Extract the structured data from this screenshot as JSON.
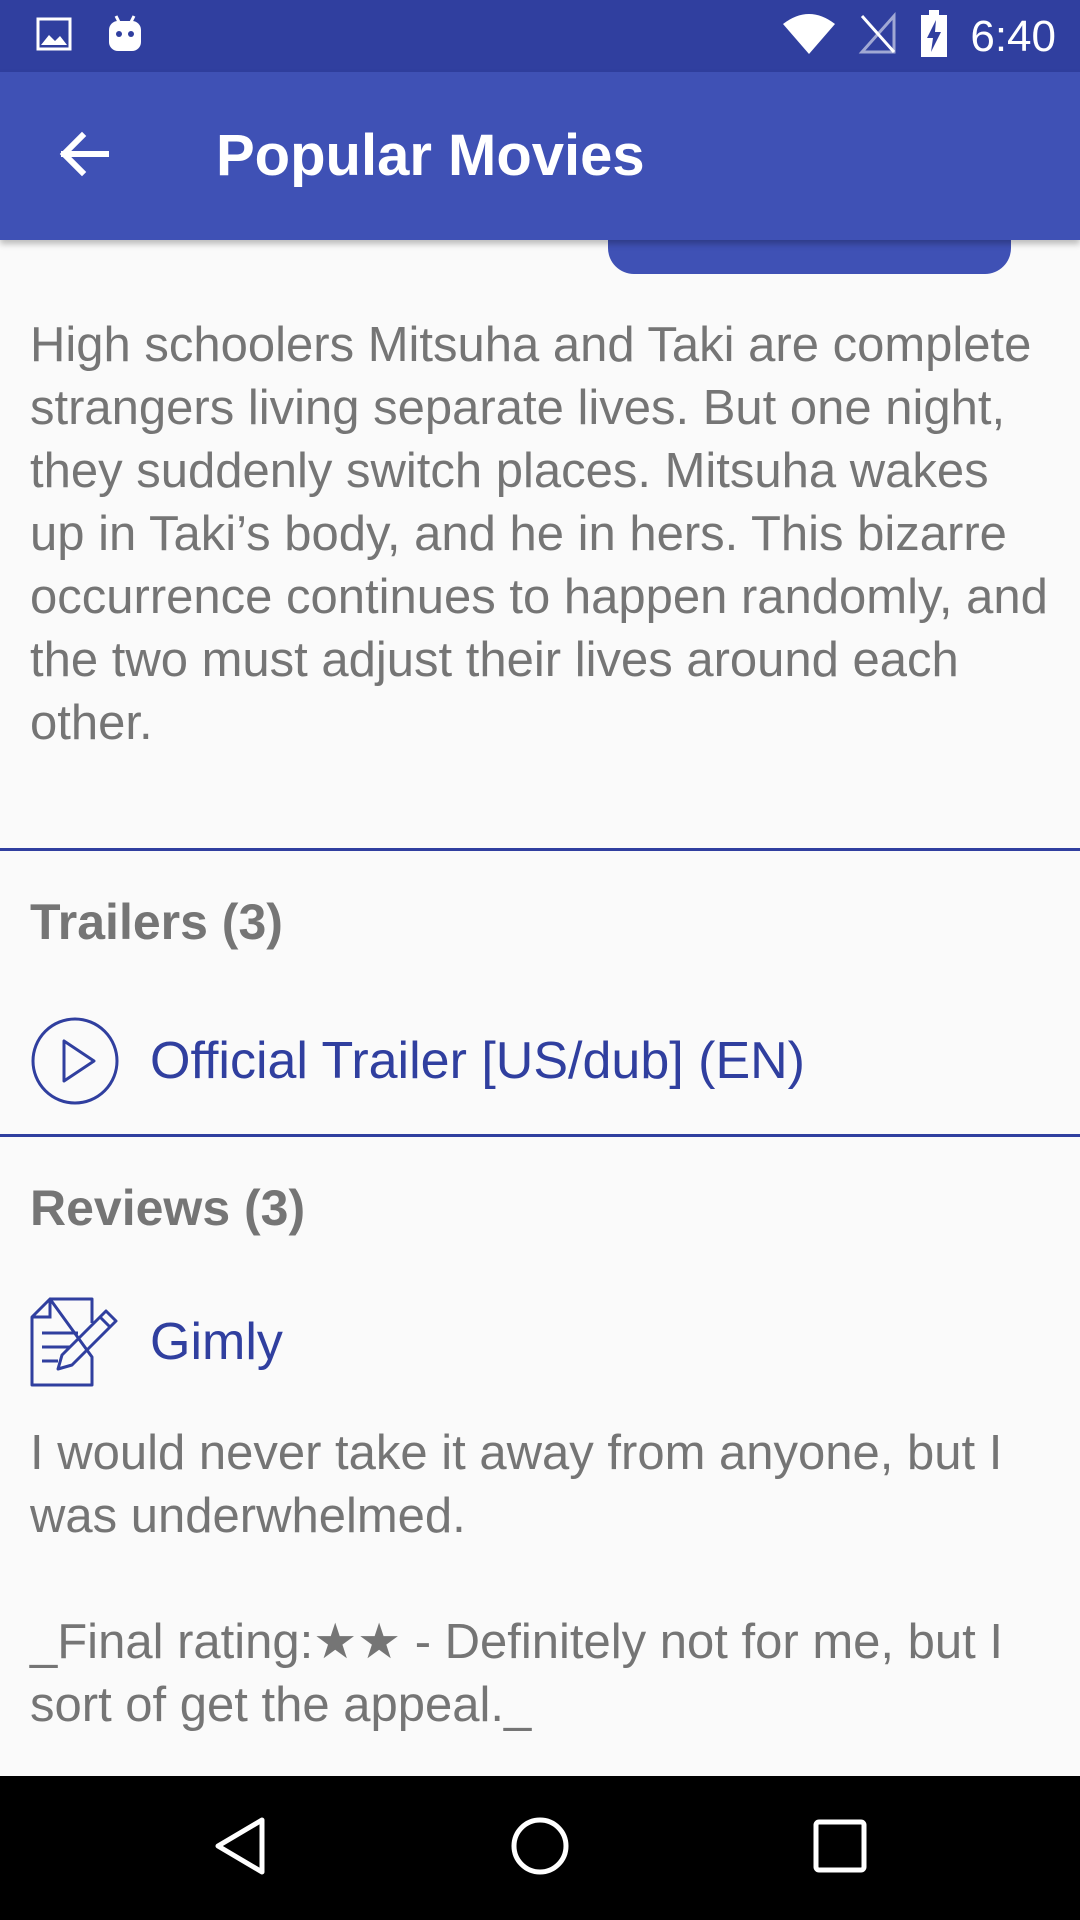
{
  "status_bar": {
    "time": "6:40",
    "icons": [
      "image-icon",
      "android-icon",
      "wifi-icon",
      "no-signal-icon",
      "battery-charging-icon"
    ]
  },
  "app_bar": {
    "title": "Popular Movies",
    "back_icon": "arrow-back-icon"
  },
  "movie": {
    "overview": "High schoolers Mitsuha and Taki are complete strangers living separate lives. But one night, they suddenly switch places. Mitsuha wakes up in Taki’s body, and he in hers. This bizarre occurrence continues to happen randomly, and the two must adjust their lives around each other."
  },
  "trailers": {
    "header": "Trailers (3)",
    "items": [
      {
        "name": "Official Trailer [US/dub] (EN)",
        "icon": "play-circle-icon"
      }
    ]
  },
  "reviews": {
    "header": "Reviews (3)",
    "items": [
      {
        "author": "Gimly",
        "icon": "review-edit-icon",
        "content": "I would never take it away from anyone, but I was underwhelmed.\n\n_Final rating:★★ - Definitely not for me, but I sort of get the appeal._"
      }
    ]
  },
  "colors": {
    "primary": "#3f51b5",
    "primary_dark": "#303f9f",
    "text_secondary": "#757575",
    "background": "#fafafa"
  },
  "nav_bar": {
    "icons": [
      "back-triangle-icon",
      "home-circle-icon",
      "recents-square-icon"
    ]
  }
}
